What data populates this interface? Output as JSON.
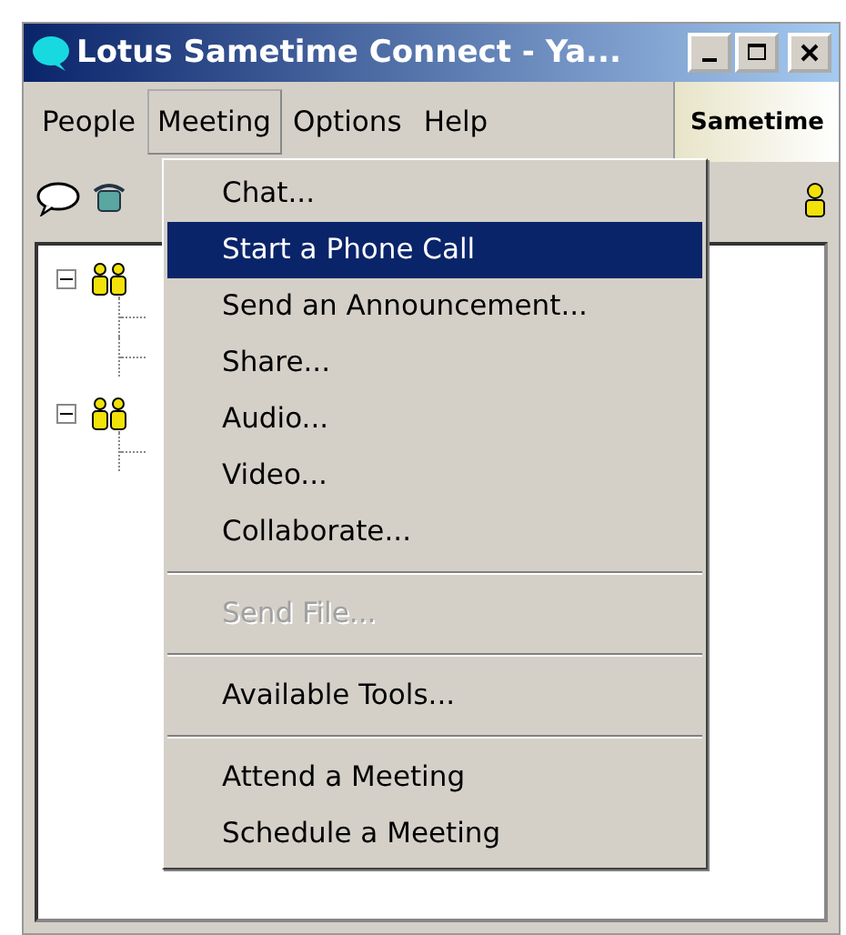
{
  "window": {
    "title": "Lotus Sametime Connect - Ya..."
  },
  "menu_bar": [
    {
      "label": "People",
      "selected": false
    },
    {
      "label": "Meeting",
      "selected": true
    },
    {
      "label": "Options",
      "selected": false
    },
    {
      "label": "Help",
      "selected": false
    }
  ],
  "brand": "Sametime",
  "tree": [
    {
      "kind": "group",
      "expanded": true,
      "children": [
        {
          "kind": "contact"
        },
        {
          "kind": "contact"
        }
      ]
    },
    {
      "kind": "group",
      "expanded": true,
      "children": [
        {
          "kind": "contact"
        }
      ]
    }
  ],
  "dropdown": [
    {
      "kind": "item",
      "label": "Chat...",
      "selected": false,
      "disabled": false
    },
    {
      "kind": "item",
      "label": "Start a Phone Call",
      "selected": true,
      "disabled": false
    },
    {
      "kind": "item",
      "label": "Send an Announcement...",
      "selected": false,
      "disabled": false
    },
    {
      "kind": "item",
      "label": "Share...",
      "selected": false,
      "disabled": false
    },
    {
      "kind": "item",
      "label": "Audio...",
      "selected": false,
      "disabled": false
    },
    {
      "kind": "item",
      "label": "Video...",
      "selected": false,
      "disabled": false
    },
    {
      "kind": "item",
      "label": "Collaborate...",
      "selected": false,
      "disabled": false
    },
    {
      "kind": "separator"
    },
    {
      "kind": "item",
      "label": "Send File...",
      "selected": false,
      "disabled": true
    },
    {
      "kind": "separator"
    },
    {
      "kind": "item",
      "label": "Available Tools...",
      "selected": false,
      "disabled": false
    },
    {
      "kind": "separator"
    },
    {
      "kind": "item",
      "label": "Attend a Meeting",
      "selected": false,
      "disabled": false
    },
    {
      "kind": "item",
      "label": "Schedule a Meeting",
      "selected": false,
      "disabled": false
    }
  ]
}
